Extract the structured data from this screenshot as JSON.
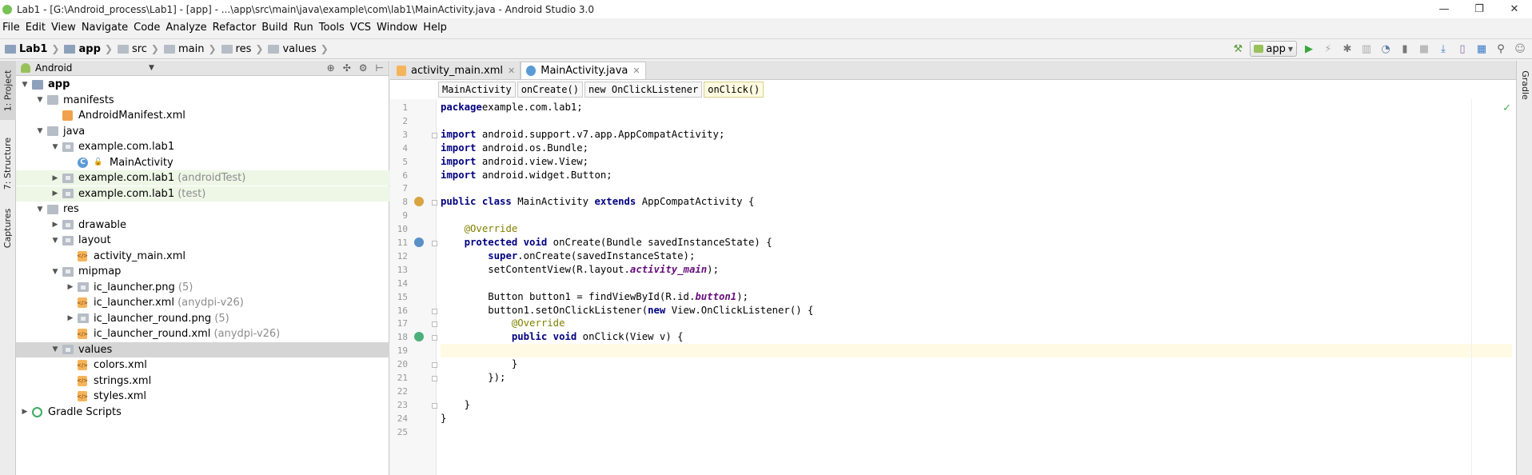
{
  "window": {
    "title": "Lab1 - [G:\\Android_process\\Lab1] - [app] - ...\\app\\src\\main\\java\\example\\com\\lab1\\MainActivity.java - Android Studio 3.0",
    "minimize": "—",
    "restore": "❐",
    "close": "✕"
  },
  "menu": [
    "File",
    "Edit",
    "View",
    "Navigate",
    "Code",
    "Analyze",
    "Refactor",
    "Build",
    "Run",
    "Tools",
    "VCS",
    "Window",
    "Help"
  ],
  "nav": {
    "crumbs": [
      "Lab1",
      "app",
      "src",
      "main",
      "res",
      "values"
    ]
  },
  "toolbar": {
    "run_config": "app",
    "icons": [
      "hammer-icon",
      "run-icon",
      "apply-changes-icon",
      "debug-icon",
      "coverage-icon",
      "profile-icon",
      "attach-icon",
      "stop-icon",
      "sdk-manager-icon",
      "avd-manager-icon",
      "project-structure-icon",
      "search-icon",
      "user-icon"
    ]
  },
  "left_tools": [
    "1: Project",
    "7: Structure",
    "Captures"
  ],
  "right_tools": [
    "Gradle"
  ],
  "project": {
    "view_mode": "Android",
    "tree": [
      {
        "label": "app",
        "bold": true,
        "extra": "",
        "level": 0,
        "arrow": "▼",
        "icon": "app"
      },
      {
        "label": "manifests",
        "extra": "",
        "level": 1,
        "arrow": "▼",
        "icon": "folder"
      },
      {
        "label": "AndroidManifest.xml",
        "extra": "",
        "level": 2,
        "arrow": "",
        "icon": "manifest"
      },
      {
        "label": "java",
        "extra": "",
        "level": 1,
        "arrow": "▼",
        "icon": "folder"
      },
      {
        "label": "example.com.lab1",
        "extra": "",
        "level": 2,
        "arrow": "▼",
        "icon": "pkg"
      },
      {
        "label": "MainActivity",
        "extra": "",
        "level": 3,
        "arrow": "",
        "icon": "cls"
      },
      {
        "label": "example.com.lab1",
        "extra": " (androidTest)",
        "level": 2,
        "arrow": "▶",
        "icon": "pkg",
        "hl": "green"
      },
      {
        "label": "example.com.lab1",
        "extra": " (test)",
        "level": 2,
        "arrow": "▶",
        "icon": "pkg",
        "hl": "green"
      },
      {
        "label": "res",
        "extra": "",
        "level": 1,
        "arrow": "▼",
        "icon": "folder"
      },
      {
        "label": "drawable",
        "extra": "",
        "level": 2,
        "arrow": "▶",
        "icon": "pkg"
      },
      {
        "label": "layout",
        "extra": "",
        "level": 2,
        "arrow": "▼",
        "icon": "pkg"
      },
      {
        "label": "activity_main.xml",
        "extra": "",
        "level": 3,
        "arrow": "",
        "icon": "xml"
      },
      {
        "label": "mipmap",
        "extra": "",
        "level": 2,
        "arrow": "▼",
        "icon": "pkg"
      },
      {
        "label": "ic_launcher.png",
        "extra": " (5)",
        "level": 3,
        "arrow": "▶",
        "icon": "pkg"
      },
      {
        "label": "ic_launcher.xml",
        "extra": " (anydpi-v26)",
        "level": 3,
        "arrow": "",
        "icon": "xml"
      },
      {
        "label": "ic_launcher_round.png",
        "extra": " (5)",
        "level": 3,
        "arrow": "▶",
        "icon": "pkg"
      },
      {
        "label": "ic_launcher_round.xml",
        "extra": " (anydpi-v26)",
        "level": 3,
        "arrow": "",
        "icon": "xml"
      },
      {
        "label": "values",
        "extra": "",
        "level": 2,
        "arrow": "▼",
        "icon": "pkg",
        "hl": "grey"
      },
      {
        "label": "colors.xml",
        "extra": "",
        "level": 3,
        "arrow": "",
        "icon": "xml"
      },
      {
        "label": "strings.xml",
        "extra": "",
        "level": 3,
        "arrow": "",
        "icon": "xml"
      },
      {
        "label": "styles.xml",
        "extra": "",
        "level": 3,
        "arrow": "",
        "icon": "xml"
      },
      {
        "label": "Gradle Scripts",
        "extra": "",
        "level": 0,
        "arrow": "▶",
        "icon": "gradle"
      }
    ]
  },
  "editor": {
    "tabs": [
      {
        "label": "activity_main.xml",
        "active": false,
        "color": "#f5b45b"
      },
      {
        "label": "MainActivity.java",
        "active": true,
        "color": "#5a9bd5"
      }
    ],
    "breadcrumbs": [
      "MainActivity",
      "onCreate()",
      "new OnClickListener",
      "onClick()"
    ],
    "caret_line": 19,
    "lines": [
      [
        [
          "kw",
          "package"
        ],
        [
          "",
          "example.com.lab1;"
        ]
      ],
      [],
      [
        [
          "kw",
          "import"
        ],
        [
          "",
          " android.support.v7.app.AppCompatActivity;"
        ]
      ],
      [
        [
          "kw",
          "import"
        ],
        [
          "",
          " android.os.Bundle;"
        ]
      ],
      [
        [
          "kw",
          "import"
        ],
        [
          "",
          " android.view.View;"
        ]
      ],
      [
        [
          "kw",
          "import"
        ],
        [
          "",
          " android.widget.Button;"
        ]
      ],
      [],
      [
        [
          "kw",
          "public class"
        ],
        [
          "",
          " MainActivity "
        ],
        [
          "kw",
          "extends"
        ],
        [
          "",
          " AppCompatActivity {"
        ]
      ],
      [],
      [
        [
          "",
          "    "
        ],
        [
          "an",
          "@Override"
        ]
      ],
      [
        [
          "",
          "    "
        ],
        [
          "kw",
          "protected void"
        ],
        [
          "",
          " onCreate(Bundle savedInstanceState) {"
        ]
      ],
      [
        [
          "",
          "        "
        ],
        [
          "kw",
          "super"
        ],
        [
          "",
          ".onCreate(savedInstanceState);"
        ]
      ],
      [
        [
          "",
          "        setContentView(R.layout."
        ],
        [
          "fld",
          "activity_main"
        ],
        [
          "",
          ");"
        ]
      ],
      [],
      [
        [
          "",
          "        Button button1 = findViewById(R.id."
        ],
        [
          "fld",
          "button1"
        ],
        [
          "",
          ");"
        ]
      ],
      [
        [
          "",
          "        button1.setOnClickListener("
        ],
        [
          "kw",
          "new"
        ],
        [
          "",
          " View.OnClickListener() {"
        ]
      ],
      [
        [
          "",
          "            "
        ],
        [
          "an",
          "@Override"
        ]
      ],
      [
        [
          "",
          "            "
        ],
        [
          "kw",
          "public void"
        ],
        [
          "",
          " onClick(View v) {"
        ]
      ],
      [],
      [
        [
          "",
          "            }"
        ]
      ],
      [
        [
          "",
          "        });"
        ]
      ],
      [],
      [
        [
          "",
          "    }"
        ]
      ],
      [
        [
          "",
          "}"
        ]
      ],
      []
    ]
  }
}
